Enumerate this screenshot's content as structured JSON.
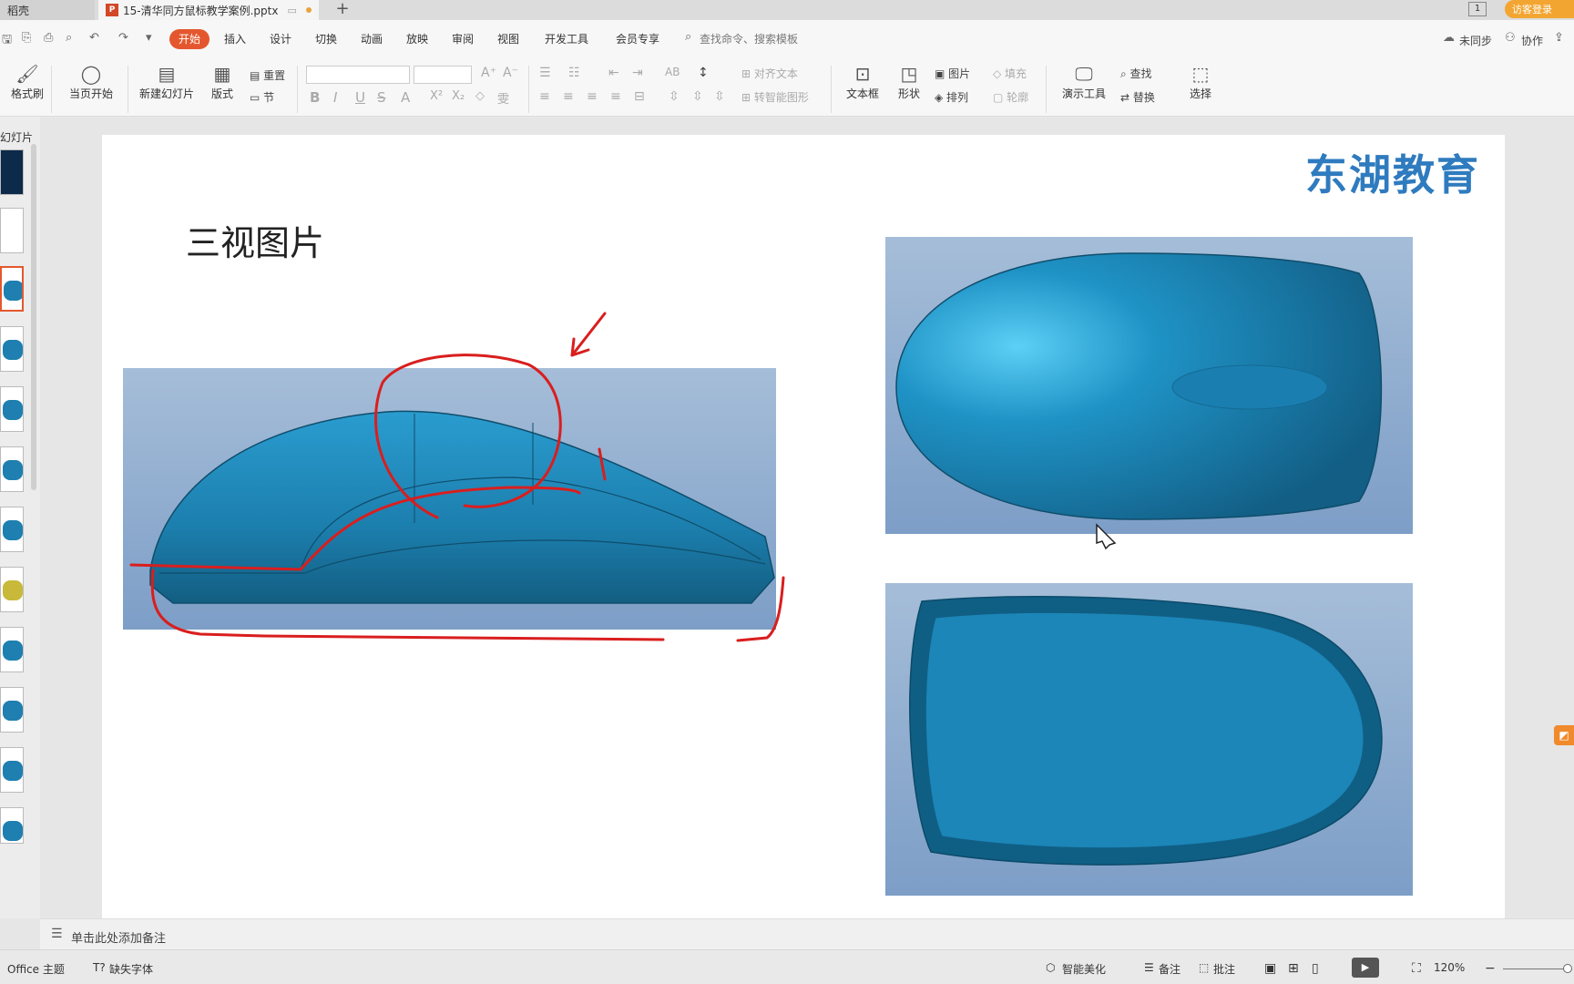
{
  "tabs": {
    "home_label": "稻壳",
    "doc_label": "15-清华同方鼠标教学案例.pptx",
    "new_tab": "+",
    "window_count": "1",
    "login": "访客登录"
  },
  "menu": {
    "items": [
      "开始",
      "插入",
      "设计",
      "切换",
      "动画",
      "放映",
      "审阅",
      "视图",
      "开发工具",
      "会员专享"
    ],
    "search_placeholder": "查找命令、搜索模板",
    "sync": "未同步",
    "collab": "协作"
  },
  "ribbon": {
    "format_painter": "格式刷",
    "from_current": "当页开始",
    "new_slide": "新建幻灯片",
    "layout": "版式",
    "section": "节",
    "reset": "重置",
    "align_text": "对齐文本",
    "smart_shape": "转智能图形",
    "textbox": "文本框",
    "shape": "形状",
    "picture": "图片",
    "arrange": "排列",
    "fill": "填充",
    "outline": "轮廓",
    "present_tools": "演示工具",
    "find": "查找",
    "replace": "替换",
    "select": "选择"
  },
  "left_panel": {
    "label": "幻灯片"
  },
  "slide": {
    "logo": "东湖教育",
    "title": "三视图片"
  },
  "notes": {
    "placeholder": "单击此处添加备注"
  },
  "status": {
    "theme": "Office 主题",
    "missing_font": "缺失字体",
    "beautify": "智能美化",
    "notes": "备注",
    "comment": "批注",
    "zoom": "120%"
  },
  "colors": {
    "accent": "#e4572e",
    "mouse_blue": "#1e7fb0",
    "annotation_red": "#d91e1e",
    "logo_blue": "#2f7bbf"
  }
}
